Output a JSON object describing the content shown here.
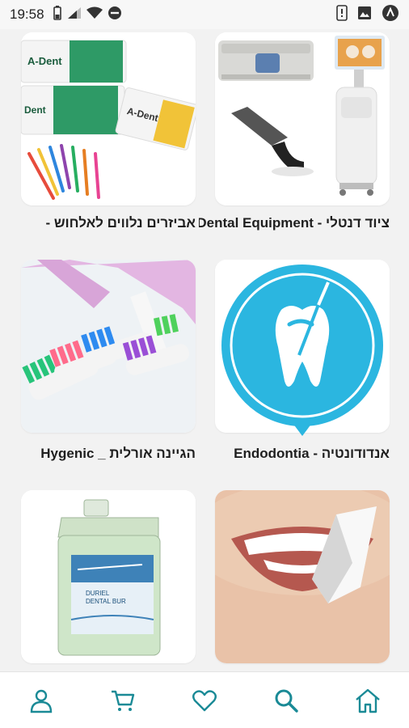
{
  "status_bar": {
    "time": "19:58"
  },
  "categories": [
    {
      "label": "ציוד דנטלי - Dental Equipment",
      "image": "dental-equipment"
    },
    {
      "label": "אביזרים נלווים לאלחוש - ",
      "image": "anesthesia-needles"
    },
    {
      "label": "אנדודונטיה - Endodontia",
      "image": "endodontia-tooth"
    },
    {
      "label": "הגיינה אורלית _ Hygenic",
      "image": "toothbrushes"
    },
    {
      "label": "",
      "image": "smile"
    },
    {
      "label": "",
      "image": "dental-bur-cleaner"
    }
  ],
  "product_text": {
    "line1": "DURIEL",
    "line2": "DENTAL BUR"
  },
  "bottom_nav": [
    {
      "name": "home",
      "icon": "home-icon"
    },
    {
      "name": "search",
      "icon": "search-icon"
    },
    {
      "name": "favorites",
      "icon": "heart-icon"
    },
    {
      "name": "cart",
      "icon": "cart-icon"
    },
    {
      "name": "account",
      "icon": "user-icon"
    }
  ],
  "colors": {
    "accent": "#1a8a96",
    "endo_blue": "#2bb6e0"
  }
}
